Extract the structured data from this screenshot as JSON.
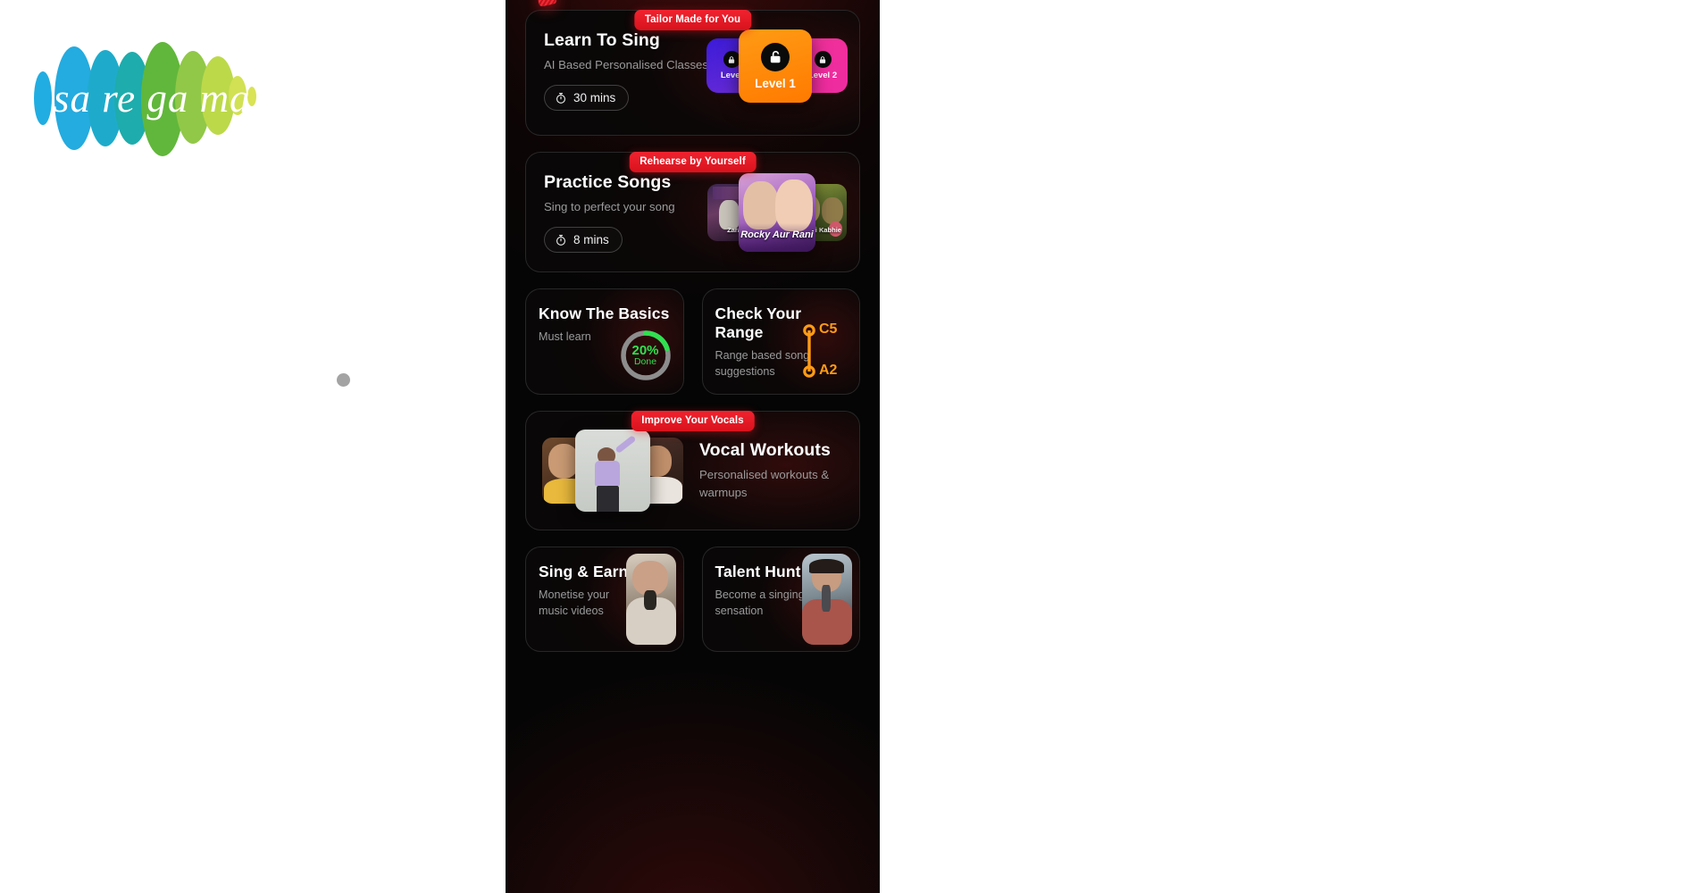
{
  "brand": {
    "logo_text": "saregama"
  },
  "cursor": {
    "name": "pointer-dot"
  },
  "app": {
    "top_partial_label": "",
    "sections": [
      {
        "ribbon": "Tailor Made for You"
      },
      {
        "ribbon": "Rehearse by Yourself"
      },
      {
        "ribbon": "Improve Your Vocals"
      }
    ]
  },
  "learn_to_sing": {
    "ribbon": "Tailor Made for You",
    "title": "Learn To Sing",
    "subtitle": "AI Based Personalised Classes",
    "duration": "30 mins",
    "levels": [
      {
        "label": "Level",
        "state": "locked",
        "icon": "lock-icon",
        "color": "#4b1ed6"
      },
      {
        "label": "Level 1",
        "state": "unlocked",
        "icon": "unlock-icon",
        "color": "#ff8a00"
      },
      {
        "label": "Level 2",
        "state": "locked",
        "icon": "lock-icon",
        "color": "#f02a9c"
      }
    ]
  },
  "practice_songs": {
    "ribbon": "Rehearse by Yourself",
    "title": "Practice Songs",
    "subtitle": "Sing to perfect your song",
    "duration": "8 mins",
    "albums": [
      {
        "caption": "Zara",
        "name": "album-thumb-left"
      },
      {
        "caption": "Rocky Aur Rani",
        "name": "album-thumb-center"
      },
      {
        "caption": "Kabhi Kabhie",
        "name": "album-thumb-right"
      }
    ]
  },
  "know_the_basics": {
    "title": "Know The Basics",
    "subtitle": "Must learn",
    "progress_percent": "20%",
    "progress_label": "Done",
    "progress_value": 20,
    "progress_color": "#2fe14f",
    "track_color": "#8d8d8d"
  },
  "check_your_range": {
    "title": "Check Your Range",
    "subtitle": "Range based song suggestions",
    "note_high": "C5",
    "note_low": "A2",
    "accent_color": "#ff9b15"
  },
  "vocal_workouts": {
    "ribbon": "Improve Your Vocals",
    "title": "Vocal Workouts",
    "subtitle": "Personalised workouts & warmups",
    "thumbs": [
      {
        "name": "workout-thumb-left"
      },
      {
        "name": "workout-thumb-center"
      },
      {
        "name": "workout-thumb-right"
      }
    ]
  },
  "promos": [
    {
      "title": "Sing & Earn",
      "subtitle": "Monetise your music videos",
      "image": "singer-photo"
    },
    {
      "title": "Talent Hunt",
      "subtitle": "Become a singing sensation",
      "image": "singer-headphones-photo"
    }
  ],
  "colors": {
    "ribbon_red": "#e0121d",
    "panel_bg": "#050505",
    "card_border": "rgba(255,255,255,0.13)",
    "title_white": "#ffffff",
    "sub_gray": "#9b9b9b"
  }
}
